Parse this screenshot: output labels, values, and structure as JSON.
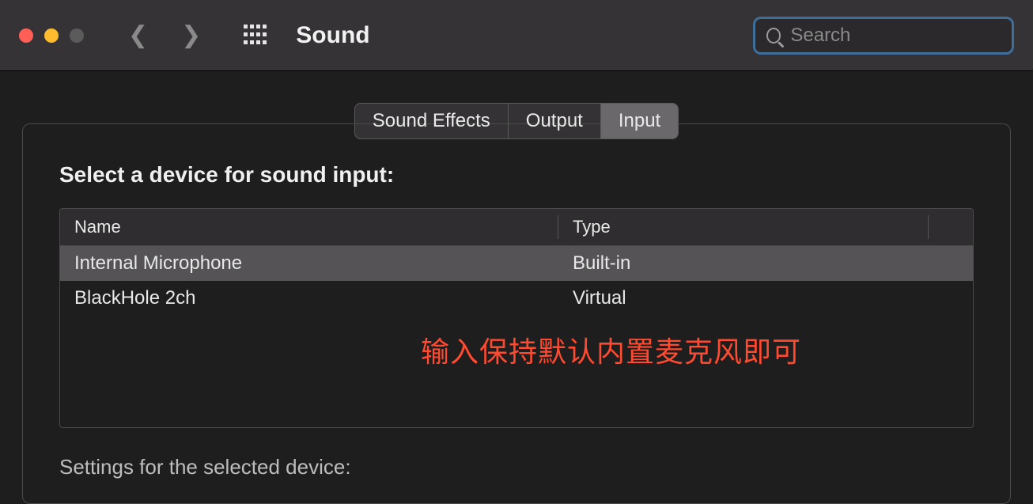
{
  "window": {
    "title": "Sound"
  },
  "search": {
    "placeholder": "Search",
    "value": ""
  },
  "tabs": {
    "effects": "Sound Effects",
    "output": "Output",
    "input": "Input"
  },
  "panel": {
    "heading": "Select a device for sound input:",
    "columns": {
      "name": "Name",
      "type": "Type"
    },
    "rows": [
      {
        "name": "Internal Microphone",
        "type": "Built-in",
        "selected": true
      },
      {
        "name": "BlackHole 2ch",
        "type": "Virtual",
        "selected": false
      }
    ],
    "subheading": "Settings for the selected device:"
  },
  "annotation": "输入保持默认内置麦克风即可"
}
